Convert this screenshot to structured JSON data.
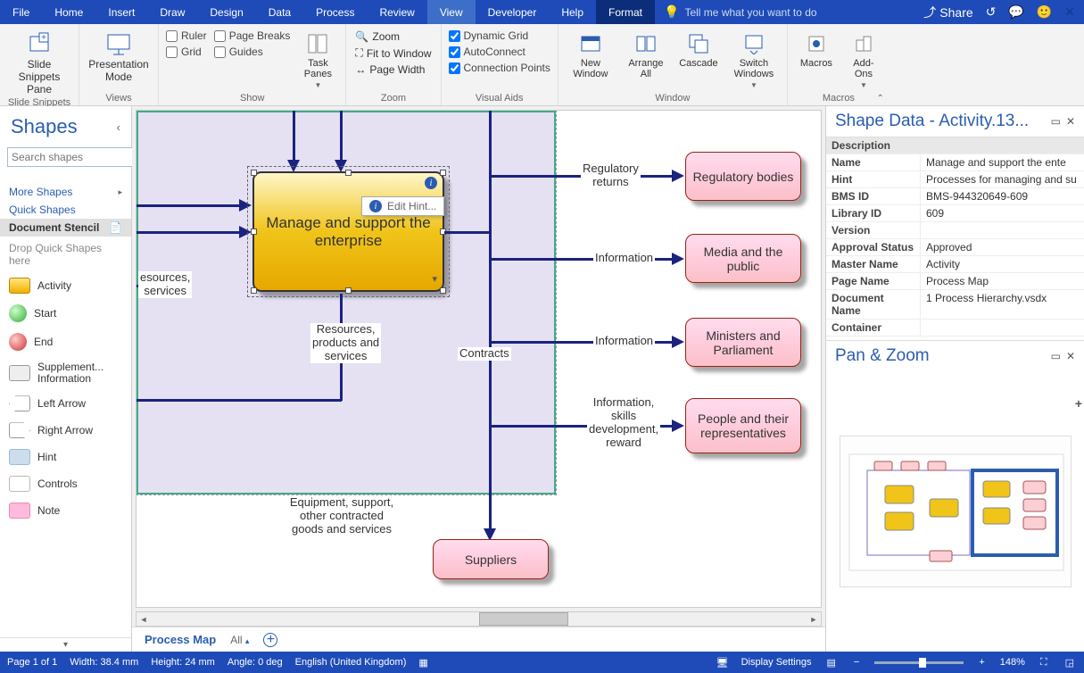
{
  "menu": [
    "File",
    "Home",
    "Insert",
    "Draw",
    "Design",
    "Data",
    "Process",
    "Review",
    "View",
    "Developer",
    "Help",
    "Format"
  ],
  "active_menu": "View",
  "tellme_placeholder": "Tell me what you want to do",
  "share_label": "Share",
  "ribbon": {
    "groups": {
      "slide_snippets": {
        "label": "Slide Snippets",
        "btn": "Slide\nSnippets Pane"
      },
      "views": {
        "label": "Views",
        "btn": "Presentation\nMode"
      },
      "show": {
        "label": "Show",
        "ruler": "Ruler",
        "page_breaks": "Page Breaks",
        "grid": "Grid",
        "guides": "Guides",
        "task_panes": "Task\nPanes"
      },
      "zoom": {
        "label": "Zoom",
        "zoom": "Zoom",
        "fit": "Fit to Window",
        "width": "Page Width"
      },
      "visual_aids": {
        "label": "Visual Aids",
        "dyn": "Dynamic Grid",
        "auto": "AutoConnect",
        "conn": "Connection Points"
      },
      "window": {
        "label": "Window",
        "new": "New\nWindow",
        "arrange": "Arrange\nAll",
        "cascade": "Cascade",
        "switch": "Switch\nWindows"
      },
      "macros": {
        "label": "Macros",
        "macros": "Macros",
        "addons": "Add-\nOns"
      }
    }
  },
  "shapes_pane": {
    "title": "Shapes",
    "search_placeholder": "Search shapes",
    "more": "More Shapes",
    "quick": "Quick Shapes",
    "stencil": "Document Stencil",
    "drop_hint": "Drop Quick Shapes here",
    "items": [
      {
        "label": "Activity",
        "color": "linear-gradient(180deg,#ffe680,#f0b000)"
      },
      {
        "label": "Start",
        "color": "radial-gradient(circle at 35% 35%, #cfc, #3a3)"
      },
      {
        "label": "End",
        "color": "radial-gradient(circle at 35% 35%, #fcc, #c33)"
      },
      {
        "label": "Supplement... Information",
        "color": "#e6e6e6"
      },
      {
        "label": "Left Arrow",
        "color": "#e6e6e6"
      },
      {
        "label": "Right Arrow",
        "color": "#e6e6e6"
      },
      {
        "label": "Hint",
        "color": "#cde"
      },
      {
        "label": "Controls",
        "color": "#eee"
      },
      {
        "label": "Note",
        "color": "#fbd"
      }
    ]
  },
  "canvas": {
    "main_shape": "Manage and support the enterprise",
    "edit_hint": "Edit Hint...",
    "labels": {
      "resources_services": "esources,\nservices",
      "resources_products": "Resources,\nproducts and\nservices",
      "contracts": "Contracts",
      "equipment": "Equipment, support,\nother contracted\ngoods and services",
      "reg_returns": "Regulatory\nreturns",
      "info1": "Information",
      "info2": "Information",
      "info_skills": "Information,\nskills\ndevelopment,\nreward"
    },
    "boxes": {
      "suppliers": "Suppliers",
      "regulatory": "Regulatory bodies",
      "media": "Media and the public",
      "ministers": "Ministers and Parliament",
      "people": "People and their representatives"
    }
  },
  "tabs": {
    "active": "Process Map",
    "all": "All"
  },
  "shape_data": {
    "title": "Shape Data - Activity.13...",
    "header": "Description",
    "rows": [
      {
        "k": "Name",
        "v": "Manage and support the ente"
      },
      {
        "k": "Hint",
        "v": "Processes for managing and su"
      },
      {
        "k": "BMS ID",
        "v": "BMS-944320649-609"
      },
      {
        "k": "Library ID",
        "v": "609"
      },
      {
        "k": "Version",
        "v": ""
      },
      {
        "k": "Approval Status",
        "v": "Approved"
      },
      {
        "k": "Master Name",
        "v": "Activity"
      },
      {
        "k": "Page Name",
        "v": "Process Map"
      },
      {
        "k": "Document Name",
        "v": "1       Process Hierarchy.vsdx"
      },
      {
        "k": "Container",
        "v": ""
      }
    ]
  },
  "panzoom_title": "Pan & Zoom",
  "status": {
    "page": "Page 1 of 1",
    "width": "Width: 38.4 mm",
    "height": "Height: 24 mm",
    "angle": "Angle: 0 deg",
    "lang": "English (United Kingdom)",
    "display": "Display Settings",
    "zoom": "148%"
  }
}
